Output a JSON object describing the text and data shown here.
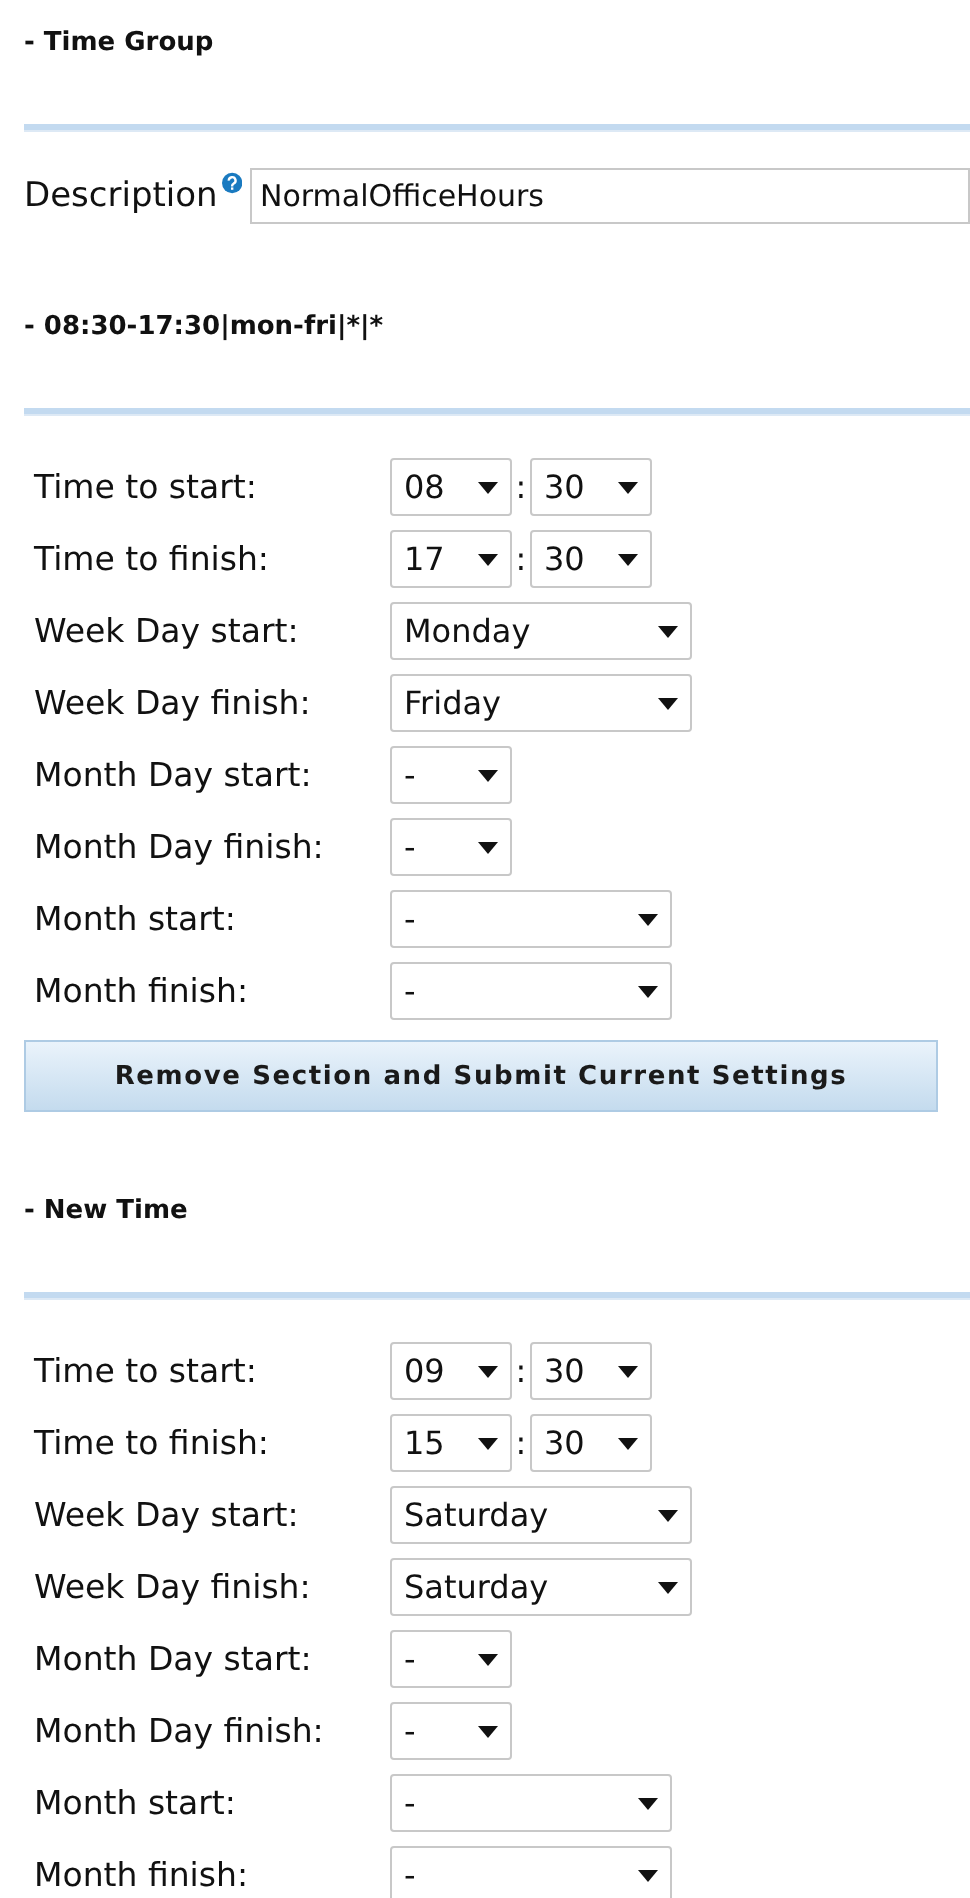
{
  "time_group": {
    "title": "- Time Group",
    "description": {
      "label": "Description",
      "value": "NormalOfficeHours"
    }
  },
  "sections": [
    {
      "title": "- 08:30-17:30|mon-fri|*|*",
      "fields": [
        {
          "kind": "time",
          "label": "Time to start:",
          "hour": "08",
          "separator": ":",
          "minute": "30"
        },
        {
          "kind": "time",
          "label": "Time to finish:",
          "hour": "17",
          "separator": ":",
          "minute": "30"
        },
        {
          "kind": "weekday",
          "label": "Week Day start:",
          "value": "Monday"
        },
        {
          "kind": "weekday",
          "label": "Week Day finish:",
          "value": "Friday"
        },
        {
          "kind": "monthday",
          "label": "Month Day start:",
          "value": "-"
        },
        {
          "kind": "monthday",
          "label": "Month Day finish:",
          "value": "-"
        },
        {
          "kind": "month",
          "label": "Month start:",
          "value": "-"
        },
        {
          "kind": "month",
          "label": "Month finish:",
          "value": "-"
        }
      ],
      "button": "Remove Section and Submit Current Settings"
    },
    {
      "title": "- New Time",
      "fields": [
        {
          "kind": "time",
          "label": "Time to start:",
          "hour": "09",
          "separator": ":",
          "minute": "30"
        },
        {
          "kind": "time",
          "label": "Time to finish:",
          "hour": "15",
          "separator": ":",
          "minute": "30"
        },
        {
          "kind": "weekday",
          "label": "Week Day start:",
          "value": "Saturday"
        },
        {
          "kind": "weekday",
          "label": "Week Day finish:",
          "value": "Saturday"
        },
        {
          "kind": "monthday",
          "label": "Month Day start:",
          "value": "-"
        },
        {
          "kind": "monthday",
          "label": "Month Day finish:",
          "value": "-"
        },
        {
          "kind": "month",
          "label": "Month start:",
          "value": "-"
        },
        {
          "kind": "month",
          "label": "Month finish:",
          "value": "-"
        }
      ]
    }
  ]
}
